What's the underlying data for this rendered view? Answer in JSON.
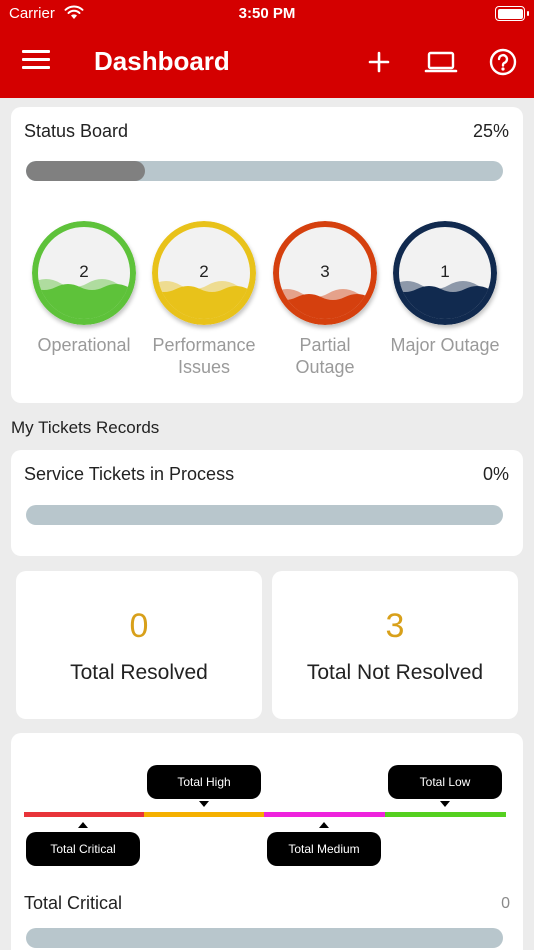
{
  "status_bar": {
    "carrier": "Carrier",
    "time": "3:50 PM"
  },
  "header": {
    "title": "Dashboard",
    "bg_color": "#d40000"
  },
  "status_board": {
    "title": "Status Board",
    "percent_text": "25%",
    "progress": 0.25,
    "gauges": [
      {
        "count": "2",
        "label_line1": "Operational",
        "label_line2": "",
        "color": "#5ec23a"
      },
      {
        "count": "2",
        "label_line1": "Performance",
        "label_line2": "Issues",
        "color": "#e8c21a"
      },
      {
        "count": "3",
        "label_line1": "Partial",
        "label_line2": "Outage",
        "color": "#d5400e"
      },
      {
        "count": "1",
        "label_line1": "Major Outage",
        "label_line2": "",
        "color": "#112a4f"
      }
    ]
  },
  "tickets": {
    "section_title": "My Tickets Records",
    "in_process_title": "Service Tickets in Process",
    "in_process_percent": "0%",
    "in_process_progress": 0,
    "resolved_count": "0",
    "resolved_label": "Total Resolved",
    "not_resolved_count": "3",
    "not_resolved_label": "Total Not Resolved"
  },
  "priority": {
    "legend": [
      {
        "label": "Total Critical",
        "color": "#e8343a"
      },
      {
        "label": "Total High",
        "color": "#f5b000"
      },
      {
        "label": "Total Medium",
        "color": "#ee22dd"
      },
      {
        "label": "Total Low",
        "color": "#55d020"
      }
    ],
    "row_title": "Total Critical",
    "row_value": "0"
  },
  "icons": {
    "menu": "hamburger-icon",
    "add": "plus-icon",
    "laptop": "laptop-icon",
    "help": "question-circle-icon"
  }
}
